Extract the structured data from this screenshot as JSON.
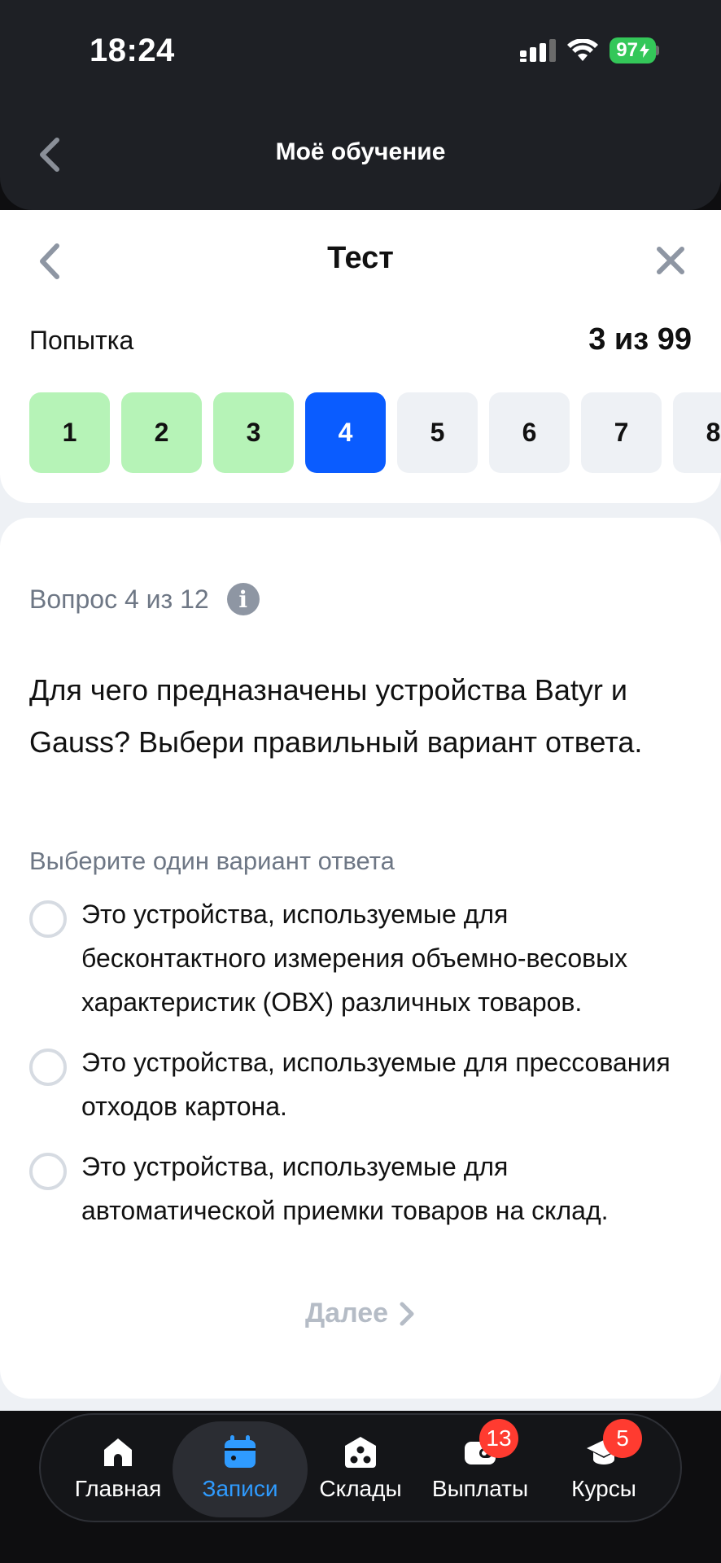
{
  "status_bar": {
    "time": "18:24",
    "battery": "97"
  },
  "app_header": {
    "title": "Моё обучение"
  },
  "test_header": {
    "title": "Тест"
  },
  "attempt": {
    "label": "Попытка",
    "value": "3 из 99"
  },
  "steps": [
    {
      "label": "1",
      "state": "done"
    },
    {
      "label": "2",
      "state": "done"
    },
    {
      "label": "3",
      "state": "done"
    },
    {
      "label": "4",
      "state": "current"
    },
    {
      "label": "5",
      "state": "todo"
    },
    {
      "label": "6",
      "state": "todo"
    },
    {
      "label": "7",
      "state": "todo"
    },
    {
      "label": "8",
      "state": "todo"
    }
  ],
  "question": {
    "counter": "Вопрос 4 из 12",
    "text": "Для чего предназначены устройства Batyr и Gauss? Выбери правильный вариант ответа.",
    "hint": "Выберите один вариант ответа",
    "options": [
      "Это устройства, используемые для бесконтактного измерения объемно-весовых характеристик (ОВХ) различных товаров.",
      "Это устройства, используемые для прессования отходов картона.",
      "Это устройства, используемые для автоматической приемки товаров на склад."
    ],
    "next_label": "Далее"
  },
  "tabbar": {
    "items": [
      {
        "label": "Главная",
        "icon": "home-icon"
      },
      {
        "label": "Записи",
        "icon": "calendar-icon",
        "active": true
      },
      {
        "label": "Склады",
        "icon": "warehouse-icon"
      },
      {
        "label": "Выплаты",
        "icon": "wallet-icon",
        "badge": "13"
      },
      {
        "label": "Курсы",
        "icon": "graduation-cap-icon",
        "badge": "5"
      }
    ]
  },
  "colors": {
    "accent": "#0a5cff",
    "done": "#b6f3b7",
    "tab_active": "#2f9bff",
    "badge": "#ff3b30"
  }
}
